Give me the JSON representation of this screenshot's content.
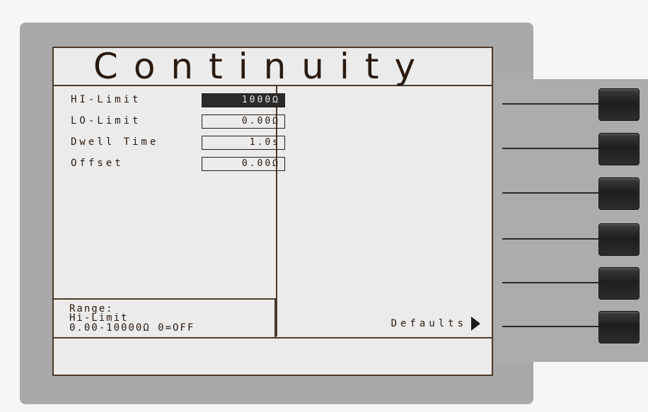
{
  "screen": {
    "title": "Continuity"
  },
  "params": [
    {
      "label": "HI-Limit",
      "value": "1000Ω",
      "selected": true
    },
    {
      "label": "LO-Limit",
      "value": "0.00Ω",
      "selected": false
    },
    {
      "label": "Dwell Time",
      "value": "1.0s",
      "selected": false
    },
    {
      "label": "Offset",
      "value": "0.00Ω",
      "selected": false
    }
  ],
  "range": {
    "line1": "Range:",
    "line2": "Hi-Limit",
    "line3": "0.00-10000Ω  0=OFF"
  },
  "softkeys": {
    "defaults_label": "Defaults"
  },
  "colors": {
    "lcd_background": "#ebebeb",
    "lcd_text": "#2a1a10",
    "bezel": "#a9a9a9",
    "key": "#1e1e1e"
  }
}
